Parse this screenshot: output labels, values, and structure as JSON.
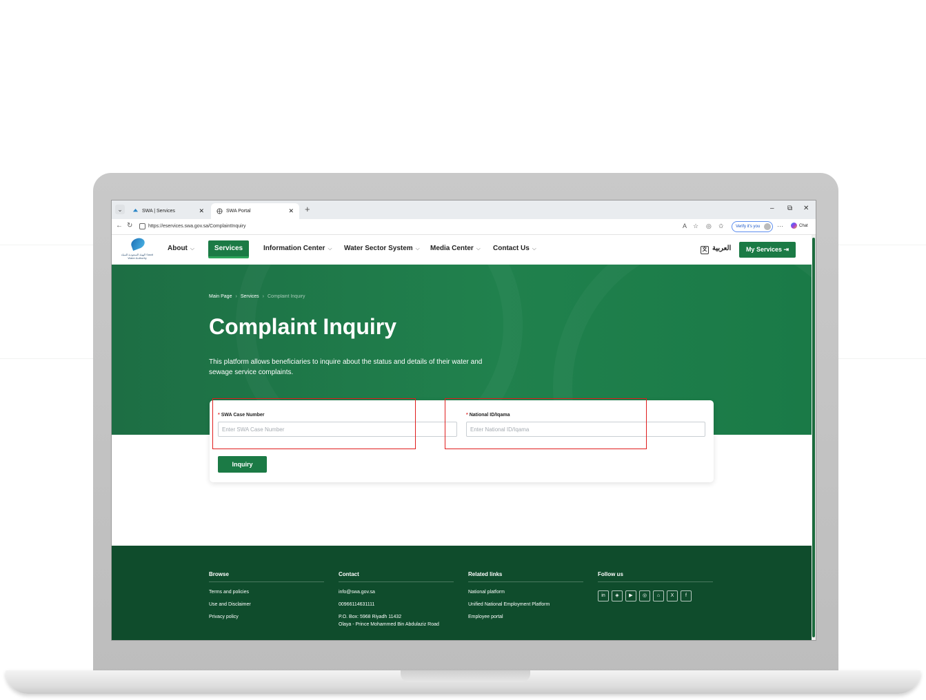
{
  "browser": {
    "tabs": [
      {
        "title": "SWA | Services",
        "active": false
      },
      {
        "title": "SWA Portal",
        "active": true
      }
    ],
    "url": "https://eservices.swa.gov.sa/ComplaintInquiry",
    "verify_label": "Verify it's you",
    "chat_label": "Chat"
  },
  "header": {
    "logo_text": "الهيئة السعودية للمياه Saudi Water Authority",
    "nav": [
      {
        "label": "About",
        "has_dropdown": true
      },
      {
        "label": "Services",
        "active": true
      },
      {
        "label": "Information Center",
        "has_dropdown": true
      },
      {
        "label": "Water Sector System",
        "has_dropdown": true
      },
      {
        "label": "Media Center",
        "has_dropdown": true
      },
      {
        "label": "Contact Us",
        "has_dropdown": true
      }
    ],
    "language_label": "العربية",
    "my_services_label": "My Services"
  },
  "hero": {
    "breadcrumb": [
      "Main Page",
      "Services",
      "Complaint Inquiry"
    ],
    "title": "Complaint Inquiry",
    "description": "This platform allows beneficiaries to inquire about the status and details of their water and sewage service complaints."
  },
  "form": {
    "case_number": {
      "label": "SWA Case Number",
      "placeholder": "Enter SWA Case Number",
      "value": "",
      "required": true
    },
    "national_id": {
      "label": "National ID/Iqama",
      "placeholder": "Enter National ID/Iqama",
      "value": "",
      "required": true
    },
    "submit_label": "Inquiry"
  },
  "footer": {
    "browse": {
      "heading": "Browse",
      "links": [
        "Terms and policies",
        "Use and Disclaimer",
        "Privacy policy"
      ]
    },
    "contact": {
      "heading": "Contact",
      "email": "info@swa.gov.sa",
      "phone": "00966114631111",
      "address_line1": "P.O. Box: 5968 Riyadh 11432",
      "address_line2": "Olaya - Prince Mohammed Bin Abdulaziz Road"
    },
    "related": {
      "heading": "Related links",
      "links": [
        "National platform",
        "Unified National Employment Platform",
        "Employee portal"
      ]
    },
    "follow": {
      "heading": "Follow us",
      "icons": [
        "linkedin-icon",
        "social-icon",
        "youtube-icon",
        "instagram-icon",
        "snapchat-icon",
        "x-icon",
        "facebook-icon"
      ]
    }
  },
  "colors": {
    "brand_green": "#1b7a45",
    "footer_green": "#0f4c2c",
    "highlight_red": "#e01c1c"
  }
}
